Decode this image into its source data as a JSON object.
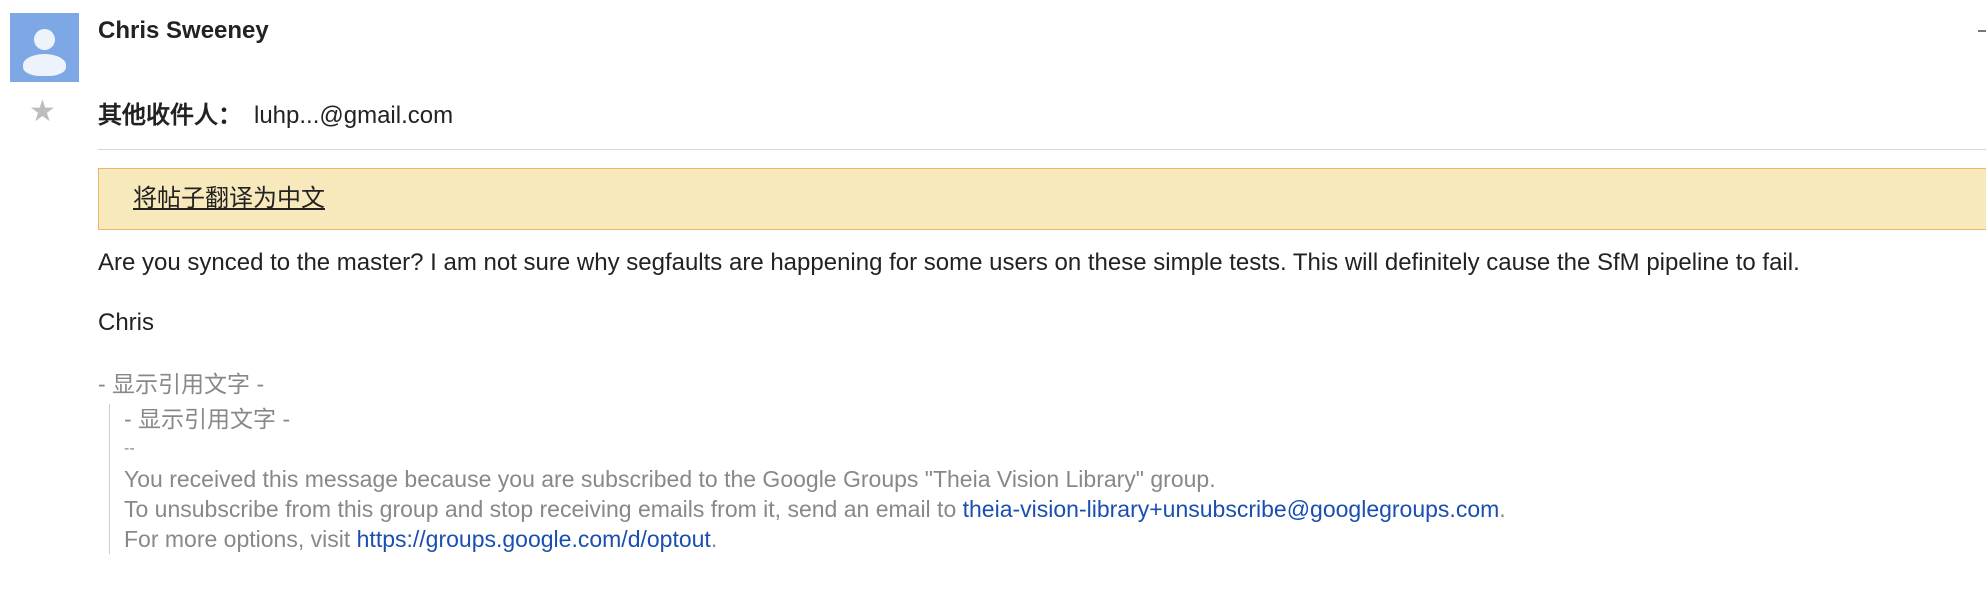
{
  "message": {
    "sender_name": "Chris Sweeney",
    "avatar_icon": "default-user-avatar-icon",
    "star_icon": "star-icon",
    "recipients_label": "其他收件人：",
    "recipients_value": "luhp...@gmail.com",
    "translate_link": "将帖子翻译为中文",
    "body_text": "Are you synced to the master? I am not sure why segfaults are happening for some users on these simple tests. This will definitely cause the SfM pipeline to fail.",
    "signature": "Chris",
    "show_quoted_text": "- 显示引用文字 -",
    "quoted": {
      "show_quoted_text": "- 显示引用文字 -",
      "separator": "--",
      "line1": "You received this message because you are subscribed to the Google Groups \"Theia Vision Library\" group.",
      "line2_prefix": "To unsubscribe from this group and stop receiving emails from it, send an email to ",
      "unsubscribe_email": "theia-vision-library+unsubscribe@googlegroups.com",
      "line2_suffix": ".",
      "line3_prefix": "For more options, visit ",
      "optout_link": "https://groups.google.com/d/optout",
      "line3_suffix": "."
    }
  },
  "colors": {
    "avatar_bg": "#7ea7e6",
    "translate_bar_bg": "#f8e9bd",
    "translate_bar_border": "#e7b869",
    "link": "#1a4fb0",
    "quoted_text": "#888888"
  }
}
